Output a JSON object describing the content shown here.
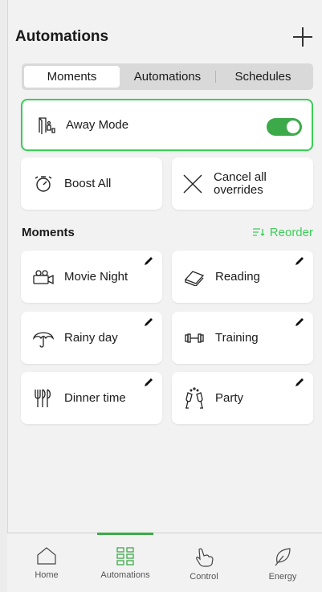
{
  "header": {
    "title": "Automations",
    "add_icon": "plus-icon"
  },
  "tabs": [
    {
      "label": "Moments",
      "active": true
    },
    {
      "label": "Automations",
      "active": false
    },
    {
      "label": "Schedules",
      "active": false
    }
  ],
  "away_mode": {
    "label": "Away Mode",
    "icon": "away-mode-icon",
    "enabled": true
  },
  "quick_actions": [
    {
      "label": "Boost All",
      "icon": "stopwatch-icon"
    },
    {
      "label": "Cancel all overrides",
      "icon": "close-icon"
    }
  ],
  "moments_section": {
    "title": "Moments",
    "reorder_label": "Reorder",
    "reorder_icon": "reorder-icon"
  },
  "moments": [
    {
      "label": "Movie Night",
      "icon": "movie-camera-icon"
    },
    {
      "label": "Reading",
      "icon": "book-icon"
    },
    {
      "label": "Rainy day",
      "icon": "umbrella-icon"
    },
    {
      "label": "Training",
      "icon": "dumbbell-icon"
    },
    {
      "label": "Dinner time",
      "icon": "cutlery-icon"
    },
    {
      "label": "Party",
      "icon": "champagne-icon"
    }
  ],
  "bottom_nav": [
    {
      "label": "Home",
      "icon": "home-icon",
      "active": false
    },
    {
      "label": "Automations",
      "icon": "grid-icon",
      "active": true
    },
    {
      "label": "Control",
      "icon": "hand-icon",
      "active": false
    },
    {
      "label": "Energy",
      "icon": "leaf-icon",
      "active": false
    }
  ],
  "colors": {
    "accent": "#3dcd58",
    "toggle": "#3daa4a",
    "background": "#f2f2f2"
  }
}
